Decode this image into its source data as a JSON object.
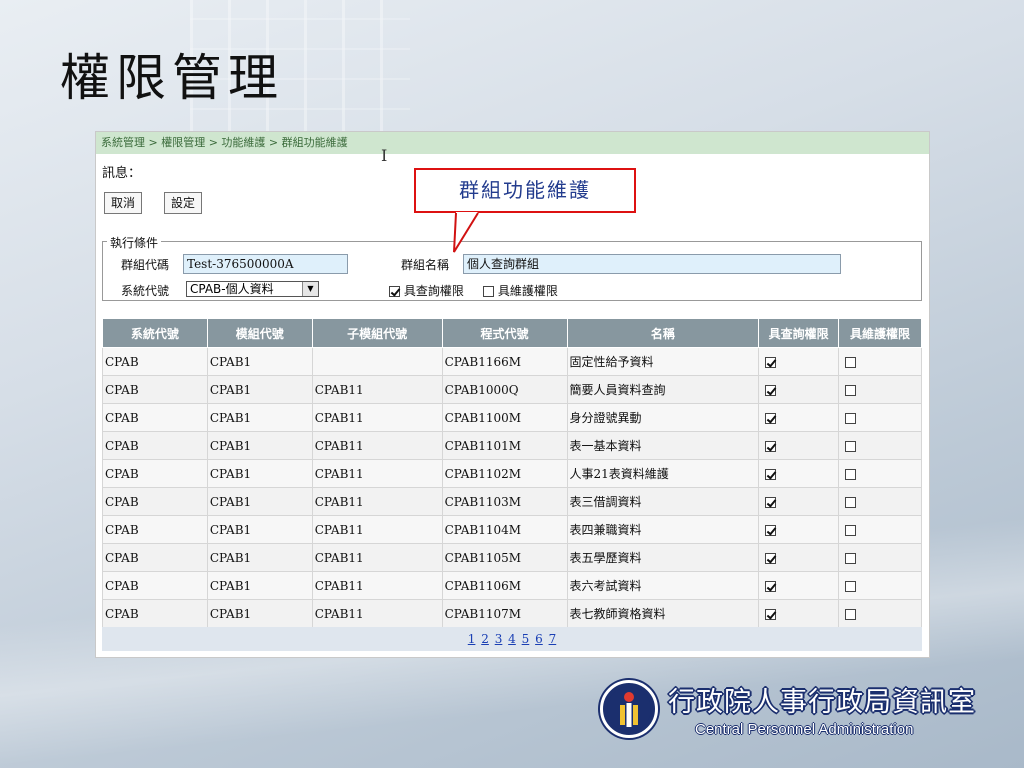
{
  "slide": {
    "title": "權限管理"
  },
  "panel": {
    "breadcrumb": "系統管理 > 權限管理 > 功能維護 > 群組功能維護",
    "message_label": "訊息：",
    "buttons": {
      "cancel": "取消",
      "set": "設定"
    },
    "callout": "群組功能維護",
    "conditions": {
      "legend": "執行條件",
      "group_code_label": "群組代碼",
      "group_code_value": "Test-376500000A",
      "group_name_label": "群組名稱",
      "group_name_value": "個人查詢群組",
      "system_code_label": "系統代號",
      "system_code_value": "CPAB-個人資料",
      "query_perm_label": "具查詢權限",
      "maintain_perm_label": "具維護權限",
      "query_perm_checked": true,
      "maintain_perm_checked": false
    },
    "table": {
      "headers": [
        "系統代號",
        "模組代號",
        "子模組代號",
        "程式代號",
        "名稱",
        "具查詢權限",
        "具維護權限"
      ],
      "rows": [
        {
          "sys": "CPAB",
          "mod": "CPAB1",
          "sub": "",
          "prog": "CPAB1166M",
          "name": "固定性給予資料",
          "query": true,
          "maint": false
        },
        {
          "sys": "CPAB",
          "mod": "CPAB1",
          "sub": "CPAB11",
          "prog": "CPAB1000Q",
          "name": "簡要人員資料查詢",
          "query": true,
          "maint": false
        },
        {
          "sys": "CPAB",
          "mod": "CPAB1",
          "sub": "CPAB11",
          "prog": "CPAB1100M",
          "name": "身分證號異動",
          "query": true,
          "maint": false
        },
        {
          "sys": "CPAB",
          "mod": "CPAB1",
          "sub": "CPAB11",
          "prog": "CPAB1101M",
          "name": "表一基本資料",
          "query": true,
          "maint": false
        },
        {
          "sys": "CPAB",
          "mod": "CPAB1",
          "sub": "CPAB11",
          "prog": "CPAB1102M",
          "name": "人事21表資料維護",
          "query": true,
          "maint": false
        },
        {
          "sys": "CPAB",
          "mod": "CPAB1",
          "sub": "CPAB11",
          "prog": "CPAB1103M",
          "name": "表三借調資料",
          "query": true,
          "maint": false
        },
        {
          "sys": "CPAB",
          "mod": "CPAB1",
          "sub": "CPAB11",
          "prog": "CPAB1104M",
          "name": "表四兼職資料",
          "query": true,
          "maint": false
        },
        {
          "sys": "CPAB",
          "mod": "CPAB1",
          "sub": "CPAB11",
          "prog": "CPAB1105M",
          "name": "表五學歷資料",
          "query": true,
          "maint": false
        },
        {
          "sys": "CPAB",
          "mod": "CPAB1",
          "sub": "CPAB11",
          "prog": "CPAB1106M",
          "name": "表六考試資料",
          "query": true,
          "maint": false
        },
        {
          "sys": "CPAB",
          "mod": "CPAB1",
          "sub": "CPAB11",
          "prog": "CPAB1107M",
          "name": "表七教師資格資料",
          "query": true,
          "maint": false
        }
      ]
    },
    "pager": [
      "1",
      "2",
      "3",
      "4",
      "5",
      "6",
      "7"
    ]
  },
  "footer": {
    "org_cn": "行政院人事行政局資訊室",
    "org_en": "Central Personnel Administration",
    "logo_icon": "emblem-icon"
  },
  "colors": {
    "breadcrumb_bg": "#cfe6cf",
    "table_header_bg": "#87979f",
    "input_bg": "#dff0fb",
    "callout_border": "#d11111",
    "logo_blue": "#1b2f6e"
  }
}
